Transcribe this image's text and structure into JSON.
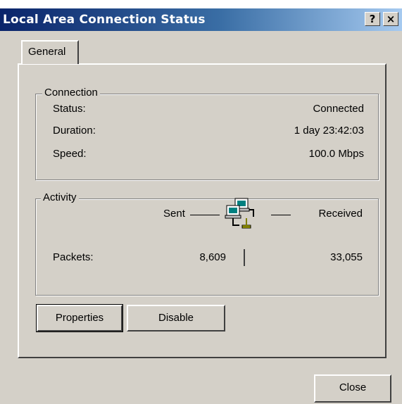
{
  "window": {
    "title": "Local Area Connection Status"
  },
  "titlebar": {
    "help_glyph": "?",
    "close_glyph": "×"
  },
  "tabs": [
    {
      "label": "General",
      "selected": true
    }
  ],
  "connection": {
    "legend": "Connection",
    "rows": [
      {
        "label": "Status:",
        "value": "Connected"
      },
      {
        "label": "Duration:",
        "value": "1 day 23:42:03"
      },
      {
        "label": "Speed:",
        "value": "100.0 Mbps"
      }
    ]
  },
  "activity": {
    "legend": "Activity",
    "sent_label": "Sent",
    "received_label": "Received",
    "icon": "network-computers-icon",
    "packets_label": "Packets:",
    "packets_sent": "8,609",
    "packets_received": "33,055"
  },
  "buttons": {
    "properties": "Properties",
    "disable": "Disable",
    "close": "Close"
  }
}
